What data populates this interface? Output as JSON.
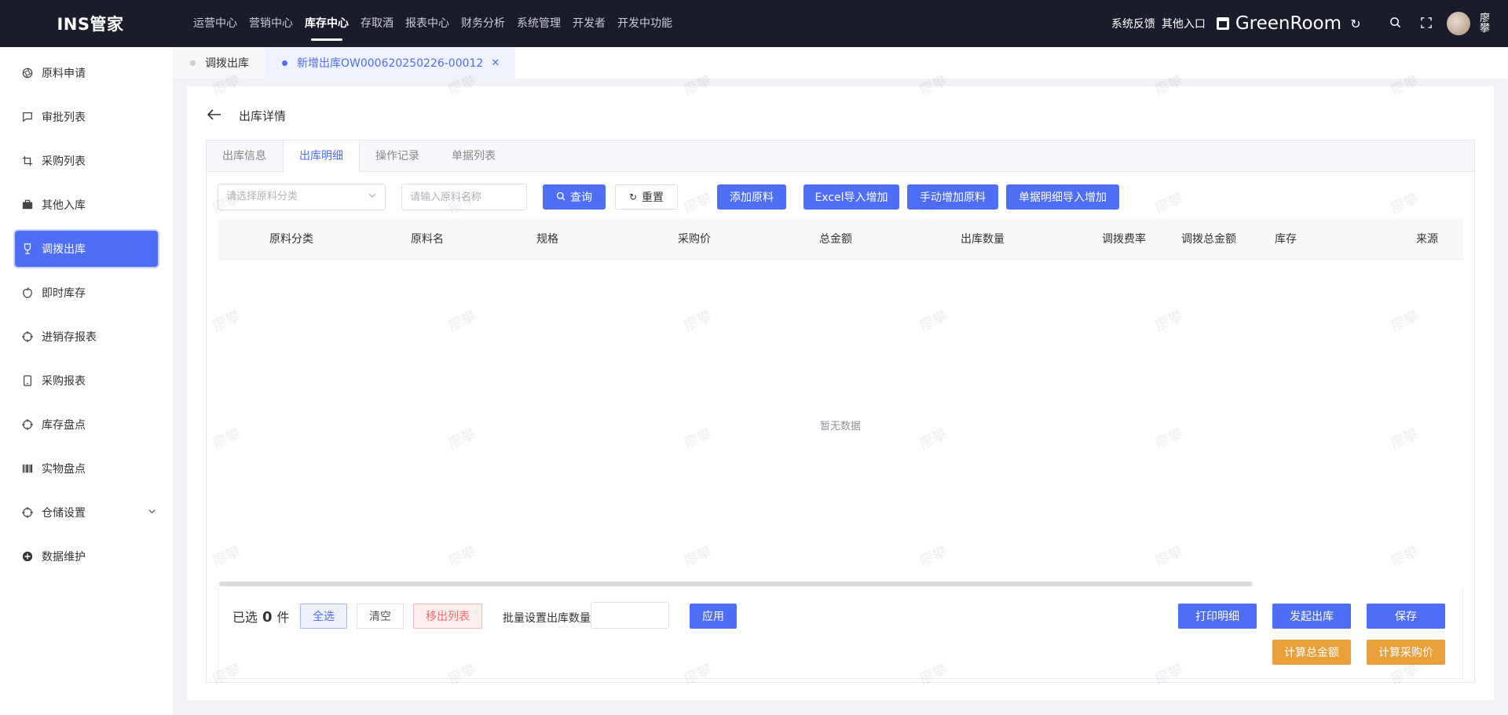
{
  "app": {
    "logo": "INS管家"
  },
  "topnav": {
    "items": [
      {
        "label": "运营中心"
      },
      {
        "label": "营销中心"
      },
      {
        "label": "库存中心"
      },
      {
        "label": "存取酒"
      },
      {
        "label": "报表中心"
      },
      {
        "label": "财务分析"
      },
      {
        "label": "系统管理"
      },
      {
        "label": "开发者"
      },
      {
        "label": "开发中功能"
      }
    ],
    "active": "库存中心"
  },
  "topright": {
    "feedback": "系统反馈",
    "other_entry": "其他入口",
    "store_name": "GreenRoom",
    "user_name": "廖攀"
  },
  "sidebar": {
    "items": [
      {
        "label": "原料申请",
        "icon": "aperture-icon"
      },
      {
        "label": "审批列表",
        "icon": "message-icon"
      },
      {
        "label": "采购列表",
        "icon": "crop-icon"
      },
      {
        "label": "其他入库",
        "icon": "briefcase-icon"
      },
      {
        "label": "调拨出库",
        "icon": "trophy-icon",
        "active": true
      },
      {
        "label": "即时库存",
        "icon": "apple-icon"
      },
      {
        "label": "进销存报表",
        "icon": "target-icon"
      },
      {
        "label": "采购报表",
        "icon": "tablet-icon"
      },
      {
        "label": "库存盘点",
        "icon": "target-icon"
      },
      {
        "label": "实物盘点",
        "icon": "barcode-icon"
      },
      {
        "label": "仓储设置",
        "icon": "target-icon",
        "expandable": true
      },
      {
        "label": "数据维护",
        "icon": "plus-circle-icon"
      }
    ]
  },
  "page_tabs": [
    {
      "label": "调拨出库",
      "active": false
    },
    {
      "label": "新增出库OW000620250226-00012",
      "active": true
    }
  ],
  "page": {
    "title": "出库详情"
  },
  "inner_tabs": [
    {
      "label": "出库信息"
    },
    {
      "label": "出库明细",
      "active": true
    },
    {
      "label": "操作记录"
    },
    {
      "label": "单据列表"
    }
  ],
  "toolbar": {
    "category_placeholder": "请选择原料分类",
    "name_placeholder": "请输入原料名称",
    "search_label": "查询",
    "reset_label": "重置",
    "add_material_label": "添加原料",
    "excel_import_label": "Excel导入增加",
    "manual_add_label": "手动增加原料",
    "detail_import_label": "单据明细导入增加"
  },
  "table": {
    "columns": [
      "原料分类",
      "原料名",
      "规格",
      "采购价",
      "总金额",
      "出库数量",
      "调拨费率",
      "调拨总金额",
      "库存",
      "来源"
    ],
    "rows": [],
    "empty_text": "暂无数据"
  },
  "footer": {
    "selected_prefix": "已选",
    "selected_count": "0",
    "selected_suffix": "件",
    "select_all_label": "全选",
    "clear_label": "清空",
    "remove_label": "移出列表",
    "batch_label": "批量设置出库数量",
    "batch_value": "",
    "apply_label": "应用",
    "print_label": "打印明细",
    "submit_label": "发起出库",
    "save_label": "保存",
    "calc_total_label": "计算总金额",
    "calc_price_label": "计算采购价"
  },
  "watermark": "廖攀",
  "colors": {
    "primary": "#4f6ef7",
    "topbar": "#1b1c29",
    "orange": "#eaa03a",
    "danger": "#f36a6a"
  }
}
